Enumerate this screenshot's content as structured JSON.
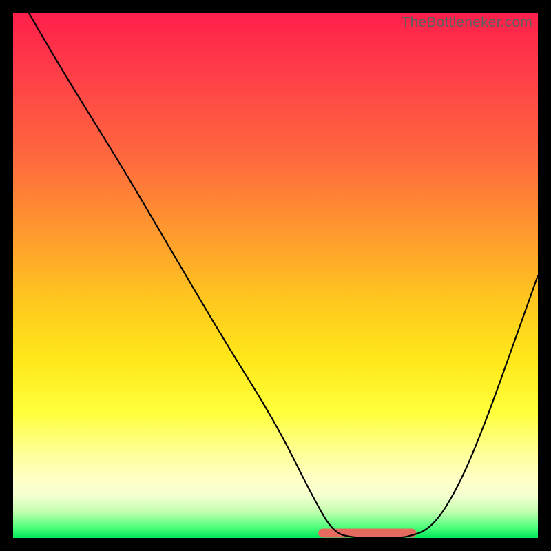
{
  "watermark": "TheBottleneker.com",
  "chart_data": {
    "type": "line",
    "title": "",
    "xlabel": "",
    "ylabel": "",
    "xlim": [
      0,
      100
    ],
    "ylim": [
      0,
      100
    ],
    "series": [
      {
        "name": "bottleneck-curve",
        "x": [
          3,
          10,
          20,
          30,
          40,
          50,
          57,
          61,
          65,
          70,
          75,
          80,
          85,
          90,
          95,
          100
        ],
        "values": [
          100,
          88,
          72,
          55,
          38,
          22,
          8,
          1,
          0,
          0,
          0,
          2,
          10,
          22,
          36,
          50
        ]
      }
    ],
    "highlight": {
      "name": "optimal-range",
      "x_start": 59,
      "x_end": 76,
      "y": 0,
      "color": "#e66a5e"
    },
    "background_gradient": {
      "top": "#ff1f4b",
      "mid": "#ffe81a",
      "bottom": "#00e85a"
    }
  }
}
